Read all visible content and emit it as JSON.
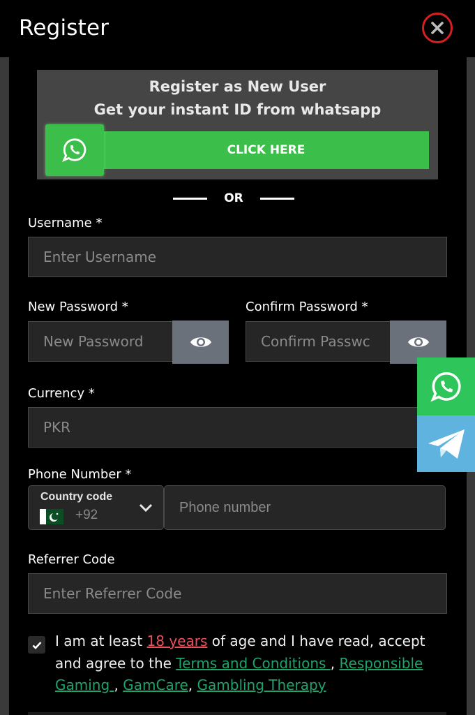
{
  "header": {
    "title": "Register",
    "close_icon": "close-icon"
  },
  "promo": {
    "line1": "Register as New User",
    "line2": "Get your instant ID from whatsapp",
    "button_label": "CLICK HERE",
    "button_icon": "whatsapp-icon"
  },
  "divider": {
    "label": "OR"
  },
  "form": {
    "username": {
      "label": "Username *",
      "placeholder": "Enter Username"
    },
    "new_password": {
      "label": "New Password *",
      "placeholder": "New Password"
    },
    "confirm_password": {
      "label": "Confirm Password *",
      "placeholder": "Confirm Passwc"
    },
    "currency": {
      "label": "Currency *",
      "value": "PKR"
    },
    "phone": {
      "label": "Phone Number *",
      "country_code_label": "Country code",
      "country_code_value": "+92",
      "country_flag": "Pakistan",
      "placeholder": "Phone number"
    },
    "referrer": {
      "label": "Referrer Code",
      "placeholder": "Enter Referrer Code"
    }
  },
  "agreement": {
    "checked": true,
    "text_1": "I am at least ",
    "link_age": "18 years",
    "text_2": " of age and I have read, accept and agree to the ",
    "link_terms": "Terms and Conditions ",
    "sep_1": ", ",
    "link_responsible": "Responsible Gaming ",
    "sep_2": ", ",
    "link_gamcare": "GamCare",
    "sep_3": ", ",
    "link_therapy": "Gambling Therapy"
  },
  "floating": {
    "whatsapp_icon": "whatsapp-icon",
    "telegram_icon": "telegram-icon"
  },
  "colors": {
    "accent_green": "#3cbe4a",
    "whatsapp_side": "#2ec55a",
    "telegram_side": "#5fb4df",
    "close_ring": "#d81f1f",
    "link_red": "#e8505c",
    "link_green": "#1fa36b"
  }
}
